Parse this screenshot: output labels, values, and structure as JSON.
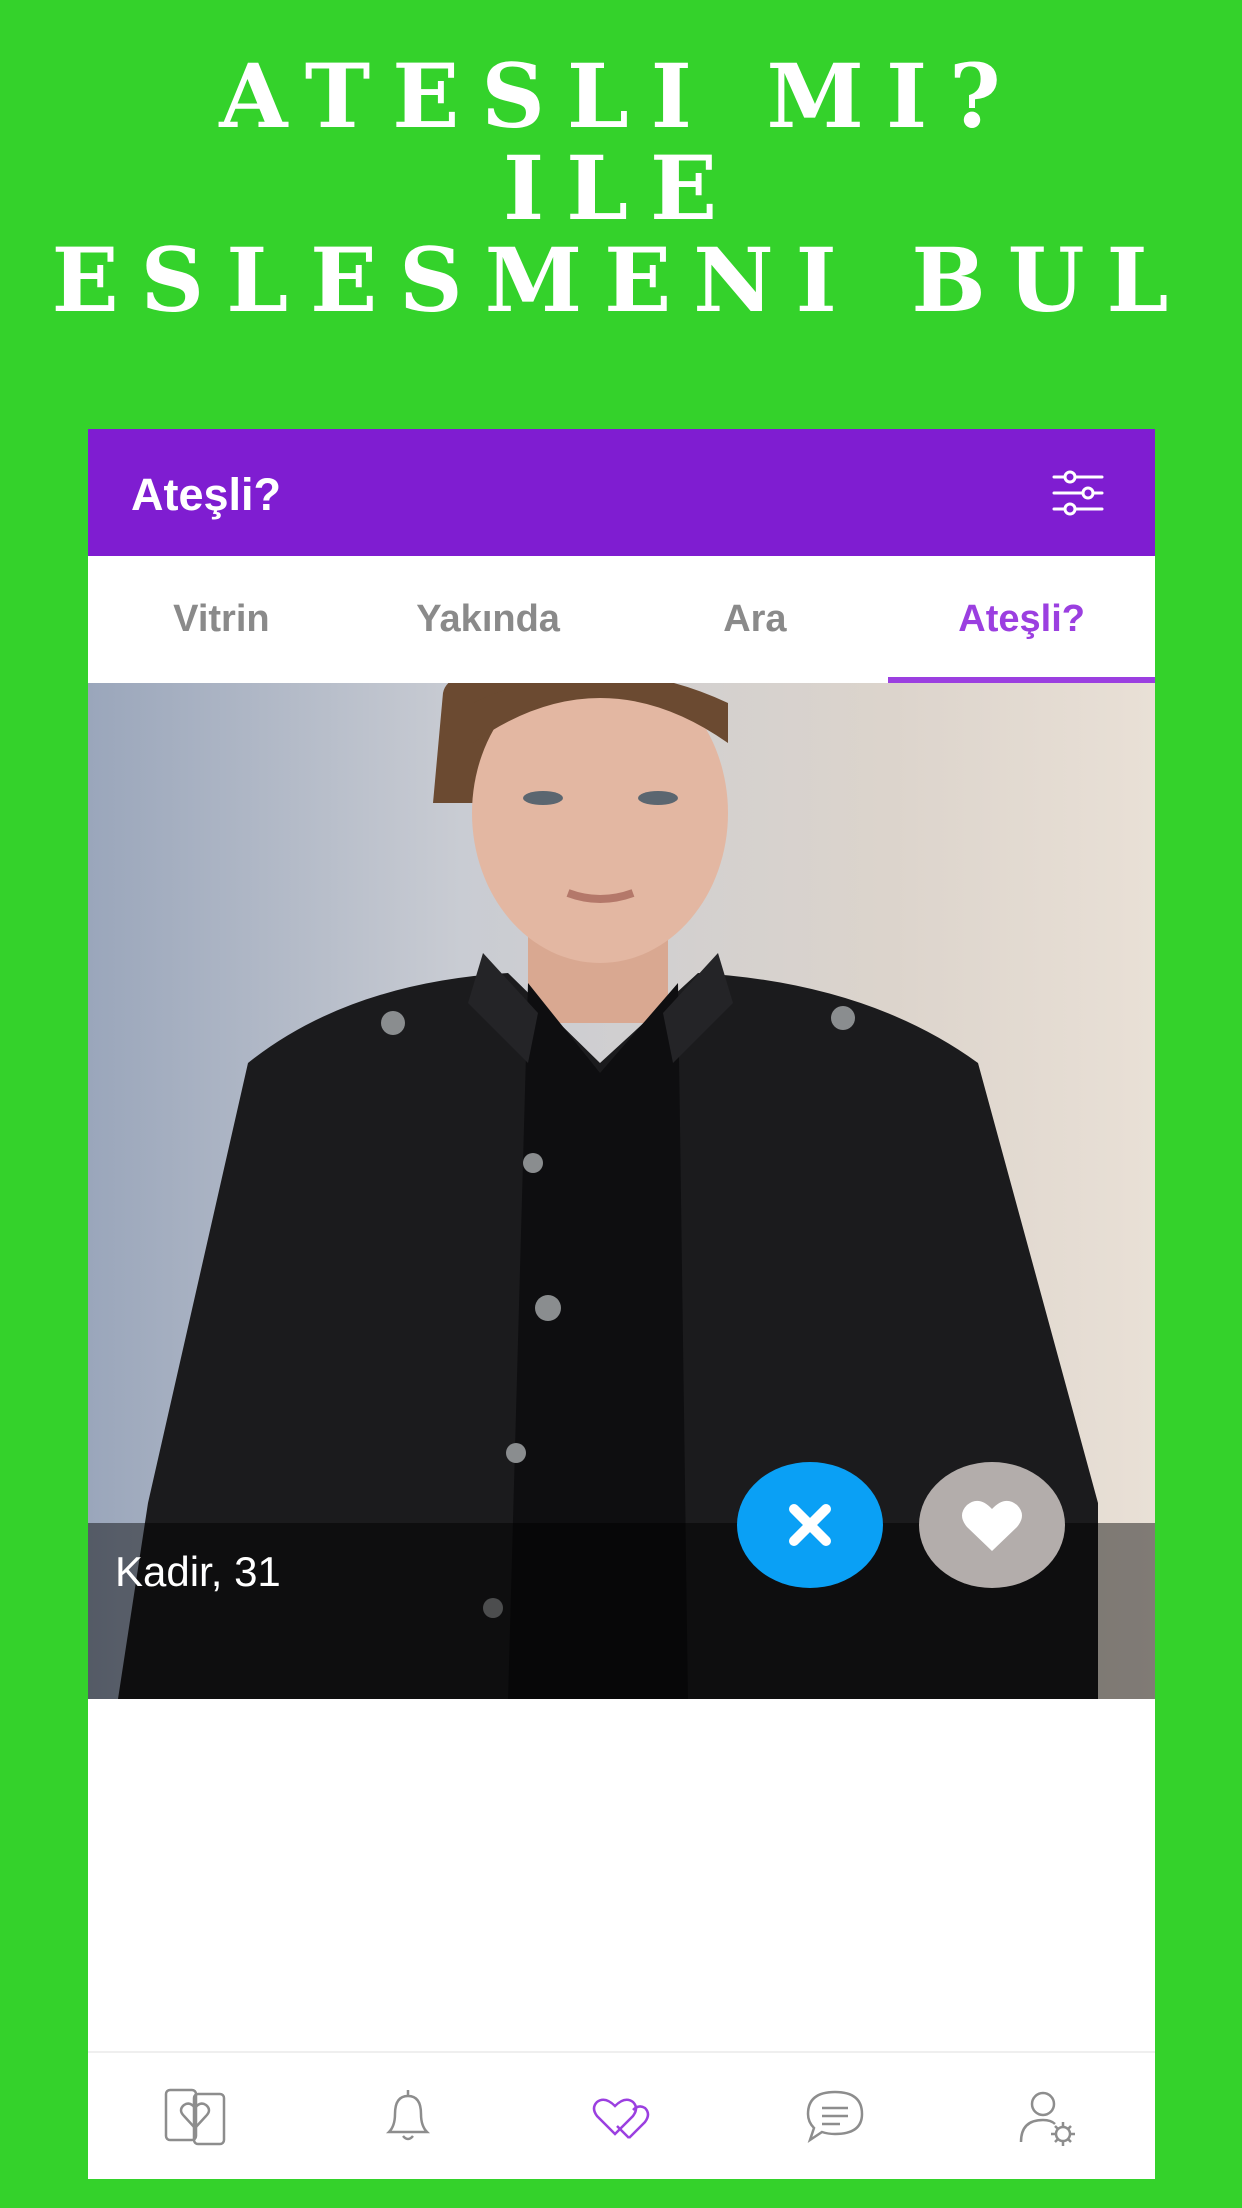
{
  "promo": {
    "line1": "ATESLI MI?",
    "line2": "ILE",
    "line3": "ESLESMENI BUL"
  },
  "appbar": {
    "title": "Ateşli?",
    "filter_icon": "sliders-icon"
  },
  "tabs": [
    {
      "label": "Vitrin",
      "active": false
    },
    {
      "label": "Yakında",
      "active": false
    },
    {
      "label": "Ara",
      "active": false
    },
    {
      "label": "Ateşli?",
      "active": true
    }
  ],
  "card": {
    "name_age": "Kadir, 31",
    "dislike_icon": "close-icon",
    "like_icon": "heart-icon"
  },
  "bottom_nav": [
    {
      "icon": "match-phones-icon",
      "active": false
    },
    {
      "icon": "bell-icon",
      "active": false
    },
    {
      "icon": "hearts-icon",
      "active": true
    },
    {
      "icon": "chat-icon",
      "active": false
    },
    {
      "icon": "profile-settings-icon",
      "active": false
    }
  ],
  "colors": {
    "background": "#34d22b",
    "appbar": "#7f1dd1",
    "accent": "#9b3fe0",
    "dislike": "#0aa0f5",
    "like": "#b3adab"
  }
}
